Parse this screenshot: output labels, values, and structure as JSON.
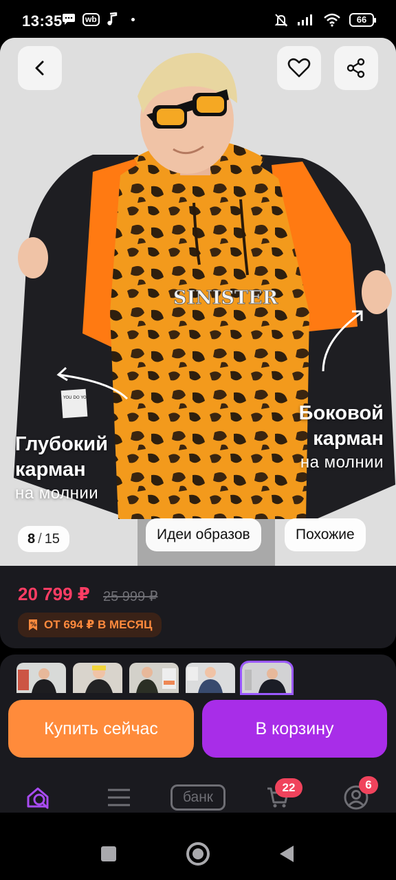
{
  "status_bar": {
    "time": "13:35",
    "app_badge": "wb",
    "battery": "66"
  },
  "product": {
    "image_counter": {
      "current": "8",
      "total": "15"
    },
    "captions": {
      "left": {
        "title_line1": "Глубокий",
        "title_line2": "карман",
        "subtitle": "на молнии"
      },
      "right": {
        "title_line1": "Боковой",
        "title_line2": "карман",
        "subtitle": "на молнии"
      }
    },
    "pill_buttons": [
      "Идеи образов",
      "Похожие"
    ],
    "print_text": "SINISTER",
    "patch_text": "YOU DO YOU",
    "price": "20 799 ₽",
    "old_price": "25 999 ₽",
    "installment": "ОТ 694 ₽ В МЕСЯЦ"
  },
  "actions": {
    "buy_now": "Купить сейчас",
    "add_to_cart": "В корзину"
  },
  "tabbar": {
    "bank_label": "банк",
    "cart_count": "22",
    "profile_count": "6"
  },
  "colors": {
    "price": "#ff3d64",
    "buy_button": "#ff8b3b",
    "cart_button": "#a82de8",
    "accent": "#9b59ff",
    "badge": "#f0435c"
  },
  "icons": [
    "back-icon",
    "heart-icon",
    "share-icon",
    "home-search-icon",
    "catalog-icon",
    "cart-icon",
    "profile-icon"
  ]
}
